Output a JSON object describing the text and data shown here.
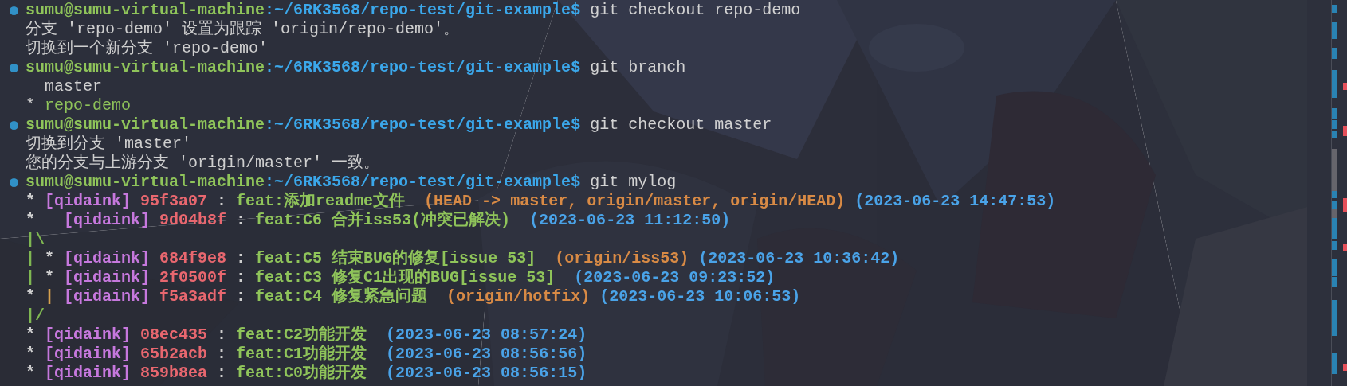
{
  "terminal": {
    "lines": [
      {
        "kind": "prompt",
        "user_host": "sumu@sumu-virtual-machine",
        "path": ":~/6RK3568/repo-test/git-example$",
        "command": "git checkout repo-demo"
      },
      {
        "kind": "output",
        "text": "分支 'repo-demo' 设置为跟踪 'origin/repo-demo'。"
      },
      {
        "kind": "output",
        "text": "切换到一个新分支 'repo-demo'"
      },
      {
        "kind": "prompt",
        "user_host": "sumu@sumu-virtual-machine",
        "path": ":~/6RK3568/repo-test/git-example$",
        "command": "git branch"
      },
      {
        "kind": "branch",
        "name": "master",
        "selected": false
      },
      {
        "kind": "branch",
        "marker": "*",
        "name": "repo-demo",
        "selected": true
      },
      {
        "kind": "prompt",
        "user_host": "sumu@sumu-virtual-machine",
        "path": ":~/6RK3568/repo-test/git-example$",
        "command": "git checkout master"
      },
      {
        "kind": "output",
        "text": "切换到分支 'master'"
      },
      {
        "kind": "output",
        "text": "您的分支与上游分支 'origin/master' 一致。"
      },
      {
        "kind": "prompt",
        "user_host": "sumu@sumu-virtual-machine",
        "path": ":~/6RK3568/repo-test/git-example$",
        "command": "git mylog"
      },
      {
        "kind": "log",
        "graph": [
          {
            "text": "*"
          }
        ],
        "author": "[qidaink]",
        "hash": "95f3a07",
        "sep": ":",
        "message": "feat:添加readme文件",
        "refs": "(HEAD -> master, origin/master, origin/HEAD)",
        "date": "(2023-06-23 14:47:53)"
      },
      {
        "kind": "log",
        "graph": [
          {
            "text": "*  "
          }
        ],
        "author": "[qidaink]",
        "hash": "9d04b8f",
        "sep": ":",
        "message": "feat:C6 合并iss53(冲突已解决)",
        "date": "(2023-06-23 11:12:50)"
      },
      {
        "kind": "graph",
        "graph": [
          {
            "text": "|\\",
            "color": "#7fb752"
          }
        ]
      },
      {
        "kind": "log",
        "graph": [
          {
            "text": "|",
            "color": "#7fb752"
          },
          {
            "text": "*"
          }
        ],
        "author": "[qidaink]",
        "hash": "684f9e8",
        "sep": ":",
        "message": "feat:C5 结束BUG的修复[issue 53]",
        "refs": "(origin/iss53)",
        "date": "(2023-06-23 10:36:42)"
      },
      {
        "kind": "log",
        "graph": [
          {
            "text": "|",
            "color": "#7fb752"
          },
          {
            "text": "*"
          }
        ],
        "author": "[qidaink]",
        "hash": "2f0500f",
        "sep": ":",
        "message": "feat:C3 修复C1出现的BUG[issue 53]",
        "date": "(2023-06-23 09:23:52)"
      },
      {
        "kind": "log",
        "graph": [
          {
            "text": "*"
          },
          {
            "text": "|",
            "color": "#d6a24e"
          }
        ],
        "author": "[qidaink]",
        "hash": "f5a3adf",
        "sep": ":",
        "message": "feat:C4 修复紧急问题",
        "refs": "(origin/hotfix)",
        "date": "(2023-06-23 10:06:53)"
      },
      {
        "kind": "graph",
        "graph": [
          {
            "text": "|/",
            "color": "#7fb752"
          }
        ]
      },
      {
        "kind": "log",
        "graph": [
          {
            "text": "*"
          }
        ],
        "author": "[qidaink]",
        "hash": "08ec435",
        "sep": ":",
        "message": "feat:C2功能开发",
        "date": "(2023-06-23 08:57:24)"
      },
      {
        "kind": "log",
        "graph": [
          {
            "text": "*"
          }
        ],
        "author": "[qidaink]",
        "hash": "65b2acb",
        "sep": ":",
        "message": "feat:C1功能开发",
        "date": "(2023-06-23 08:56:56)"
      },
      {
        "kind": "log",
        "graph": [
          {
            "text": "*"
          }
        ],
        "author": "[qidaink]",
        "hash": "859b8ea",
        "sep": ":",
        "message": "feat:C0功能开发",
        "date": "(2023-06-23 08:56:15)"
      }
    ]
  }
}
